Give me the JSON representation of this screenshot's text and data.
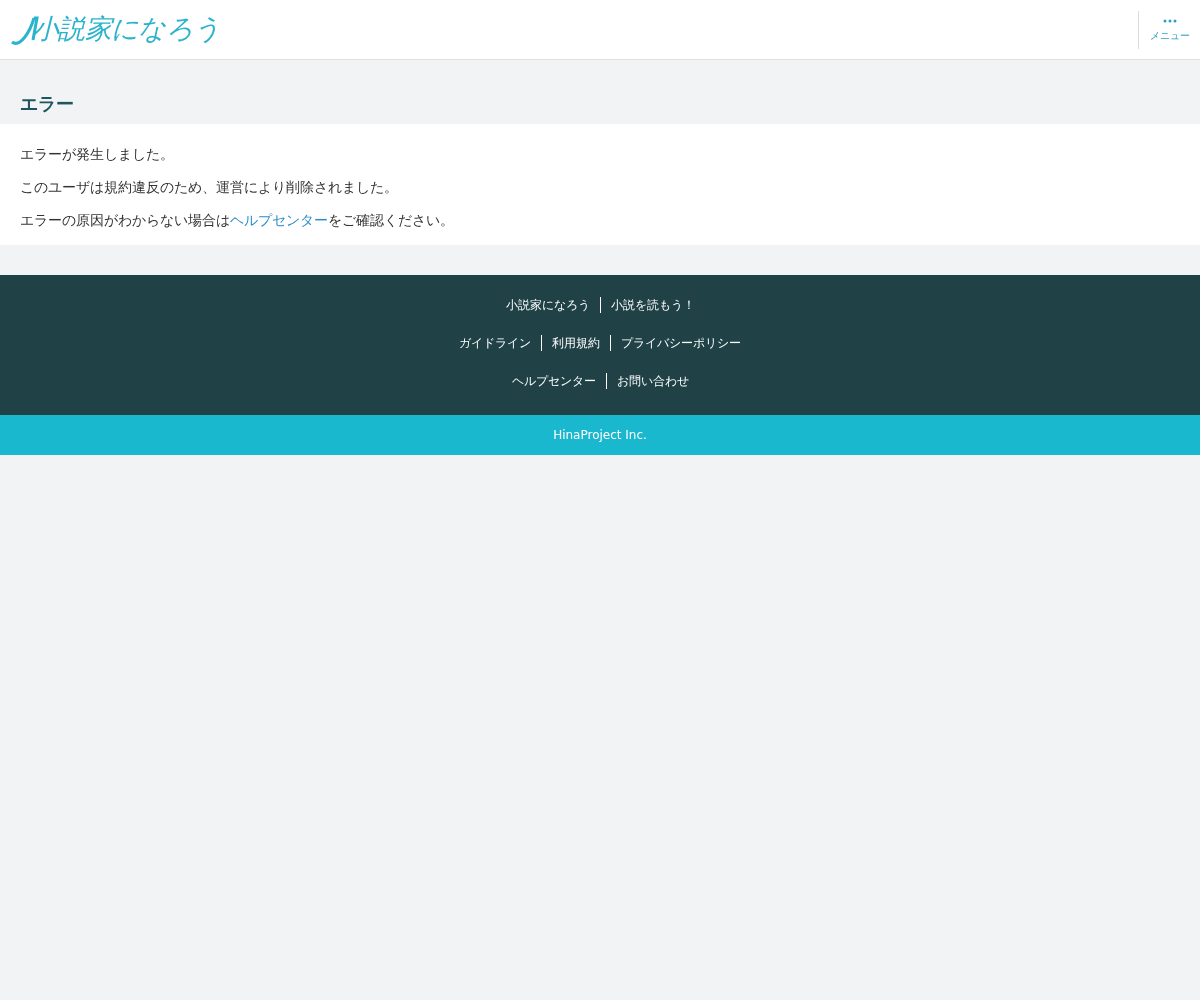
{
  "header": {
    "logo": "小説家になろう",
    "menu_label": "メニュー"
  },
  "page": {
    "title": "エラー",
    "paragraphs": [
      {
        "text": "エラーが発生しました。"
      },
      {
        "text": "このユーザは規約違反のため、運営により削除されました。"
      },
      {
        "before": "エラーの原因がわからない場合は",
        "link": "ヘルプセンター",
        "after": "をご確認ください。"
      }
    ]
  },
  "footer": {
    "link_groups": [
      {
        "links": [
          {
            "label": "小説家になろう"
          },
          {
            "label": "小説を読もう！"
          }
        ]
      },
      {
        "links": [
          {
            "label": "ガイドライン"
          },
          {
            "label": "利用規約"
          },
          {
            "label": "プライバシーポリシー"
          }
        ]
      },
      {
        "links": [
          {
            "label": "ヘルプセンター"
          },
          {
            "label": "お問い合わせ"
          }
        ]
      }
    ],
    "copyright": "HinaProject Inc."
  }
}
